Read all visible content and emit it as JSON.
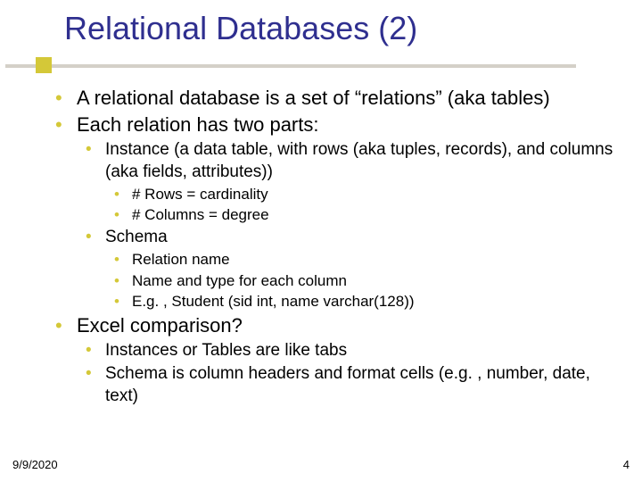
{
  "title": "Relational Databases (2)",
  "bullets": {
    "a": "A relational database is a set of “relations” (aka tables)",
    "b": "Each relation has two parts:",
    "b1": "Instance (a data table, with rows (aka tuples, records), and columns (aka fields, attributes))",
    "b1a": "# Rows = cardinality",
    "b1b": "# Columns = degree",
    "b2": "Schema",
    "b2a": "Relation name",
    "b2b": "Name and type for each column",
    "b2c": "E.g. , Student (sid int, name varchar(128))",
    "c": "Excel comparison?",
    "c1": "Instances or Tables are like tabs",
    "c2": "Schema is column headers and format cells (e.g. , number, date, text)"
  },
  "footer": {
    "date": "9/9/2020",
    "page": "4"
  }
}
